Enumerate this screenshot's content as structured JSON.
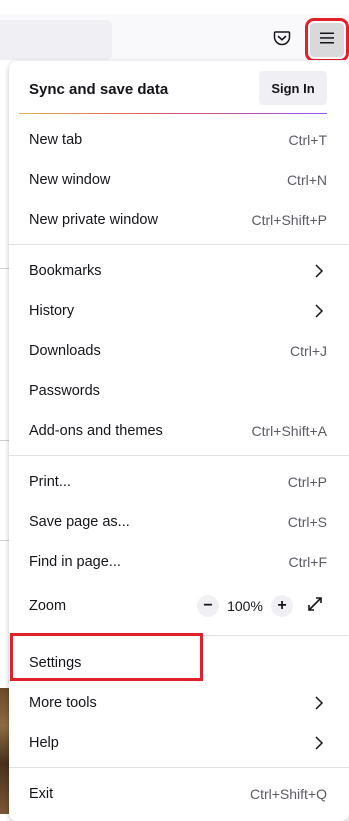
{
  "colors": {
    "highlight": "#e0202a",
    "text": "#15141a",
    "shortcut": "#5b5b66"
  },
  "toolbar": {
    "pocket_icon": "pocket-icon",
    "menu_icon": "hamburger-menu-icon"
  },
  "menu": {
    "sync_title": "Sync and save data",
    "sign_in": "Sign In",
    "new_tab": {
      "label": "New tab",
      "shortcut": "Ctrl+T"
    },
    "new_window": {
      "label": "New window",
      "shortcut": "Ctrl+N"
    },
    "new_private_window": {
      "label": "New private window",
      "shortcut": "Ctrl+Shift+P"
    },
    "bookmarks": {
      "label": "Bookmarks"
    },
    "history": {
      "label": "History"
    },
    "downloads": {
      "label": "Downloads",
      "shortcut": "Ctrl+J"
    },
    "passwords": {
      "label": "Passwords"
    },
    "addons": {
      "label": "Add-ons and themes",
      "shortcut": "Ctrl+Shift+A"
    },
    "print": {
      "label": "Print...",
      "shortcut": "Ctrl+P"
    },
    "save_page": {
      "label": "Save page as...",
      "shortcut": "Ctrl+S"
    },
    "find": {
      "label": "Find in page...",
      "shortcut": "Ctrl+F"
    },
    "zoom": {
      "label": "Zoom",
      "minus": "−",
      "value": "100%",
      "plus": "+"
    },
    "settings": {
      "label": "Settings"
    },
    "more_tools": {
      "label": "More tools"
    },
    "help": {
      "label": "Help"
    },
    "exit": {
      "label": "Exit",
      "shortcut": "Ctrl+Shift+Q"
    }
  }
}
